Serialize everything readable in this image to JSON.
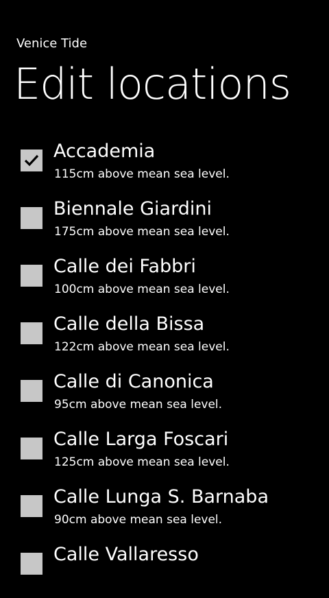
{
  "app": {
    "title": "Venice Tide"
  },
  "page": {
    "title": "Edit locations"
  },
  "colors": {
    "background": "#000000",
    "text": "#ffffff",
    "checkbox": "#c7c7c7",
    "checkmark": "#000000"
  },
  "locations": [
    {
      "name": "Accademia",
      "level": "115cm above mean sea level.",
      "checked": true
    },
    {
      "name": "Biennale Giardini",
      "level": "175cm above mean sea level.",
      "checked": false
    },
    {
      "name": "Calle dei Fabbri",
      "level": "100cm above mean sea level.",
      "checked": false
    },
    {
      "name": "Calle della Bissa",
      "level": "122cm above mean sea level.",
      "checked": false
    },
    {
      "name": "Calle di Canonica",
      "level": "95cm above mean sea level.",
      "checked": false
    },
    {
      "name": "Calle Larga Foscari",
      "level": "125cm above mean sea level.",
      "checked": false
    },
    {
      "name": "Calle Lunga S. Barnaba",
      "level": "90cm above mean sea level.",
      "checked": false
    },
    {
      "name": "Calle Vallaresso",
      "level": "",
      "checked": false
    }
  ]
}
